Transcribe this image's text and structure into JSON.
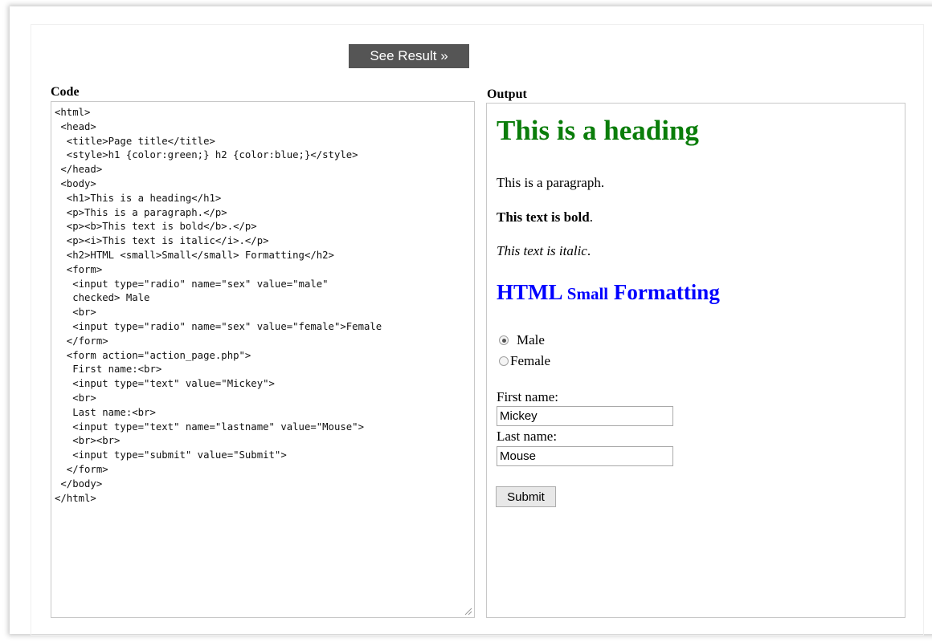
{
  "toolbar": {
    "see_result_label": "See Result »"
  },
  "code_pane": {
    "label": "Code",
    "lines": [
      "<html>",
      " <head>",
      "  <title>Page title</title>",
      "  <style>h1 {color:green;} h2 {color:blue;}</style>",
      " </head>",
      " <body>",
      "  <h1>This is a heading</h1>",
      "  <p>This is a paragraph.</p>",
      "  <p><b>This text is bold</b>.</p>",
      "  <p><i>This text is italic</i>.</p>",
      "  <h2>HTML <small>Small</small> Formatting</h2>",
      "  <form>",
      "   <input type=\"radio\" name=\"sex\" value=\"male\"",
      "   checked> Male",
      "   <br>",
      "   <input type=\"radio\" name=\"sex\" value=\"female\">Female",
      "  </form>",
      "  <form action=\"action_page.php\">",
      "   First name:<br>",
      "   <input type=\"text\" value=\"Mickey\">",
      "   <br>",
      "   Last name:<br>",
      "   <input type=\"text\" name=\"lastname\" value=\"Mouse\">",
      "   <br><br>",
      "   <input type=\"submit\" value=\"Submit\">",
      "  </form>",
      " </body>",
      "</html>"
    ]
  },
  "output_pane": {
    "label": "Output",
    "heading": "This is a heading",
    "heading_color": "#0a7d0a",
    "paragraph": "This is a paragraph.",
    "bold_text": "This text is bold",
    "bold_suffix": ".",
    "italic_text": "This text is italic",
    "italic_suffix": ".",
    "h2_prefix": "HTML ",
    "h2_small": "Small",
    "h2_suffix": " Formatting",
    "h2_color": "#0000ff",
    "radio_male_label": "Male",
    "radio_female_label": "Female",
    "radio_male_checked": true,
    "first_name_label": "First name:",
    "first_name_value": "Mickey",
    "last_name_label": "Last name:",
    "last_name_value": "Mouse",
    "submit_label": "Submit"
  }
}
